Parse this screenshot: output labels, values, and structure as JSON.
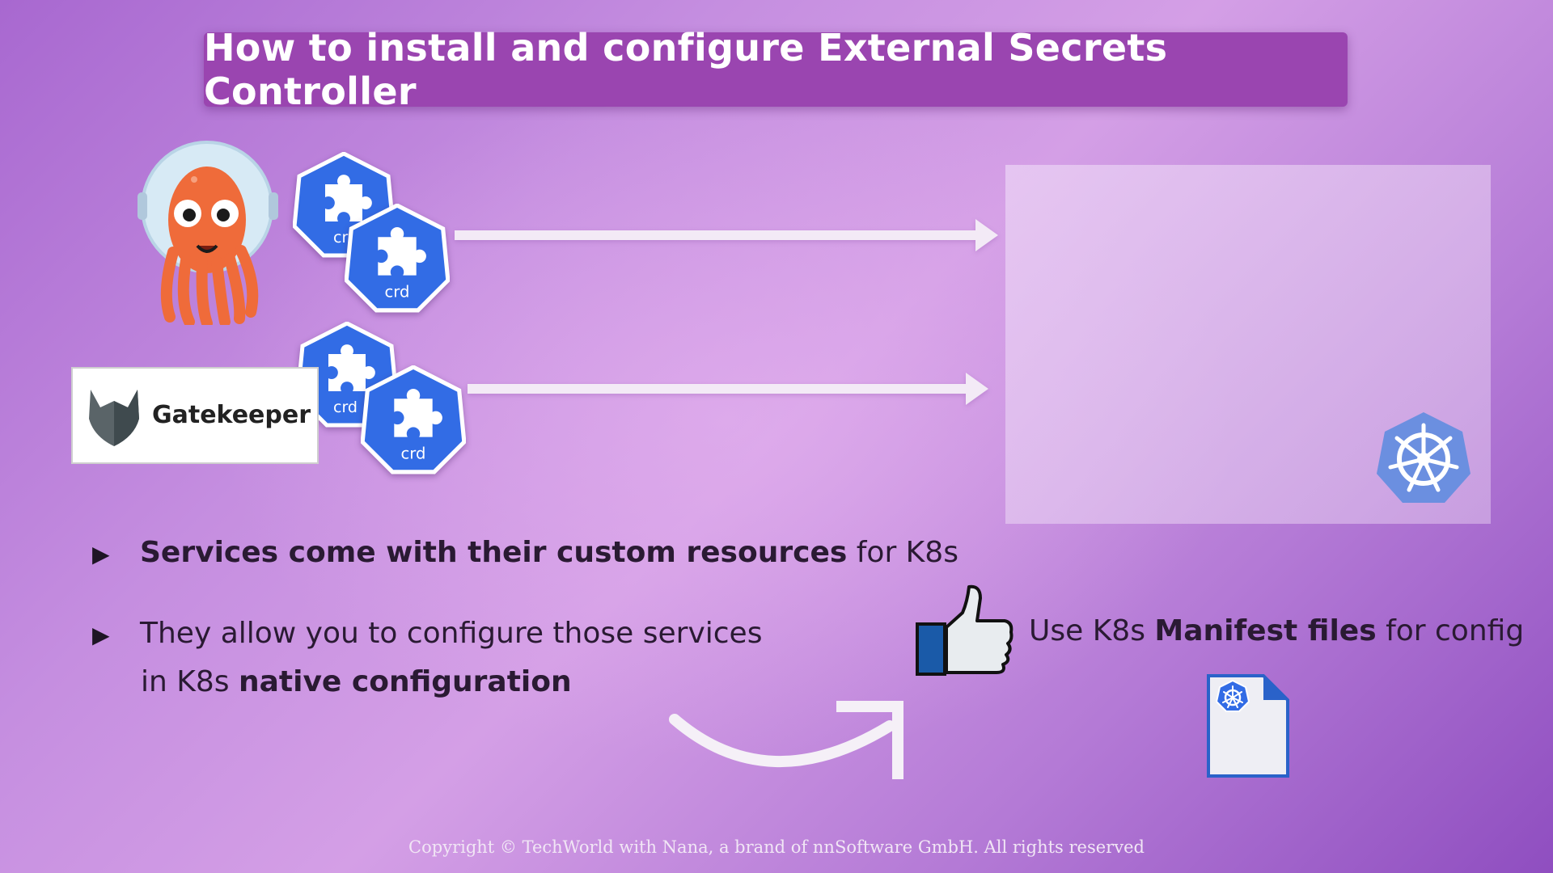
{
  "title": "How to install and configure External Secrets Controller",
  "crd_label": "crd",
  "gatekeeper": {
    "name": "Gatekeeper"
  },
  "bullets": [
    {
      "bold": "Services come with their custom resources",
      "rest": " for K8s"
    },
    {
      "line1": "They allow you to configure those services",
      "line2_prefix": "in K8s ",
      "line2_bold": "native configuration"
    }
  ],
  "manifest": {
    "prefix": "Use K8s ",
    "bold": "Manifest files",
    "suffix": " for config"
  },
  "copyright": "Copyright © TechWorld with Nana, a brand of nnSoftware GmbH. All rights reserved",
  "colors": {
    "title_bg": "#9a45b0",
    "crd_blue": "#326ce5",
    "k8s_blue": "#6b8fe0",
    "thumb_blue": "#1a5aa8"
  },
  "icons": [
    "argo-octopus-icon",
    "puzzle-crd-icon",
    "gatekeeper-logo-icon",
    "kubernetes-wheel-icon",
    "thumbs-up-icon",
    "manifest-file-icon",
    "curved-arrow-icon"
  ]
}
